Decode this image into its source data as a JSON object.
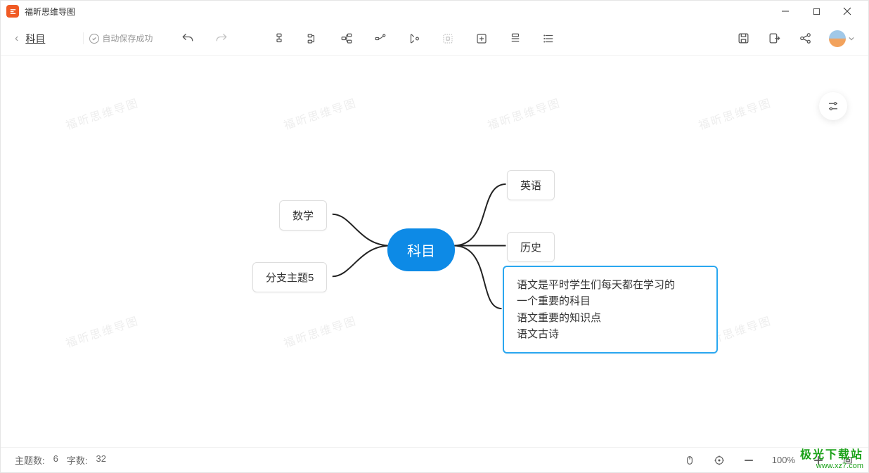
{
  "app": {
    "title": "福昕思维导图",
    "doc_name": "科目",
    "save_status": "自动保存成功"
  },
  "mindmap": {
    "center": "科目",
    "left": {
      "top": "数学",
      "bottom": "分支主题5"
    },
    "right": {
      "top": "英语",
      "mid": "历史",
      "selected": {
        "line1": "语文是平时学生们每天都在学习的",
        "line2": "一个重要的科目",
        "line3": "语文重要的知识点",
        "line4": "语文古诗"
      }
    }
  },
  "watermark": "福昕思维导图",
  "status": {
    "topic_label": "主题数:",
    "topic_count": "6",
    "word_label": "字数:",
    "word_count": "32",
    "zoom": "100%"
  },
  "attrib": {
    "cn": "极光下载站",
    "domain": "www.xz7.com"
  }
}
